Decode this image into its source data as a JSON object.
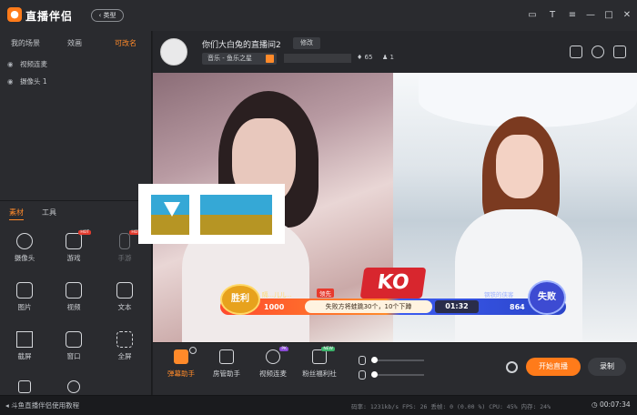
{
  "app": {
    "name": "直播伴侣",
    "type_button": "类型"
  },
  "window_controls": [
    "□",
    "T",
    "≡",
    "—",
    "□",
    "✕"
  ],
  "left_tabs": [
    "我的场景",
    "效画",
    "可改名"
  ],
  "sources": [
    {
      "label": "视频连麦",
      "icon": "eye-icon"
    },
    {
      "label": "摄像头 1",
      "icon": "eye-icon"
    }
  ],
  "material_tabs": [
    "素材",
    "工具"
  ],
  "materials": [
    {
      "label": "摄像头",
      "icon": "camera-icon"
    },
    {
      "label": "游戏",
      "icon": "gamepad-icon",
      "badge": "HOT"
    },
    {
      "label": "手游",
      "icon": "phone-icon",
      "badge": "HOT",
      "dim": true
    },
    {
      "label": "图片",
      "icon": "image-icon"
    },
    {
      "label": "视频",
      "icon": "video-icon"
    },
    {
      "label": "文本",
      "icon": "text-icon"
    },
    {
      "label": "截屏",
      "icon": "crop-icon"
    },
    {
      "label": "窗口",
      "icon": "window-icon"
    },
    {
      "label": "全屏",
      "icon": "fullscreen-icon"
    }
  ],
  "stream": {
    "title": "你们大白兔的直播间2",
    "edit_label": "修改",
    "category": "音乐 - 鱼乐之星",
    "likes": "65",
    "viewers": "1"
  },
  "pk": {
    "win_label": "胜利",
    "lose_label": "失败",
    "left_name": "隔…儿儿…",
    "leading_tag": "领先",
    "right_name": "钢铁的侠客",
    "left_score": "1000",
    "right_score": "864",
    "message": "失败方将蛙跳30个，10个下蹲",
    "timer": "01:32",
    "ko": "KO"
  },
  "bottom_tools": [
    {
      "label": "弹幕助手",
      "icon": "danmu-icon",
      "active": true
    },
    {
      "label": "房管助手",
      "icon": "house-icon"
    },
    {
      "label": "视频连麦",
      "icon": "mic-link-icon",
      "badge": "PK"
    },
    {
      "label": "粉丝福利社",
      "icon": "gift-icon",
      "badge": "NEW"
    }
  ],
  "actions": {
    "start": "开始直播",
    "record": "录制"
  },
  "status": {
    "tutorial": "斗鱼直播伴侣使用教程",
    "stats": "码率: 1231kb/s   FPS: 26   丢帧: 0 (0.00 %)   CPU: 45%   内存: 24%",
    "time": "00:07:34"
  },
  "colors": {
    "accent": "#ff7b1a",
    "win": "#e7a21d",
    "lose": "#3d4bd2",
    "logo_blue": "#35a8d6",
    "logo_gold": "#b69524"
  }
}
